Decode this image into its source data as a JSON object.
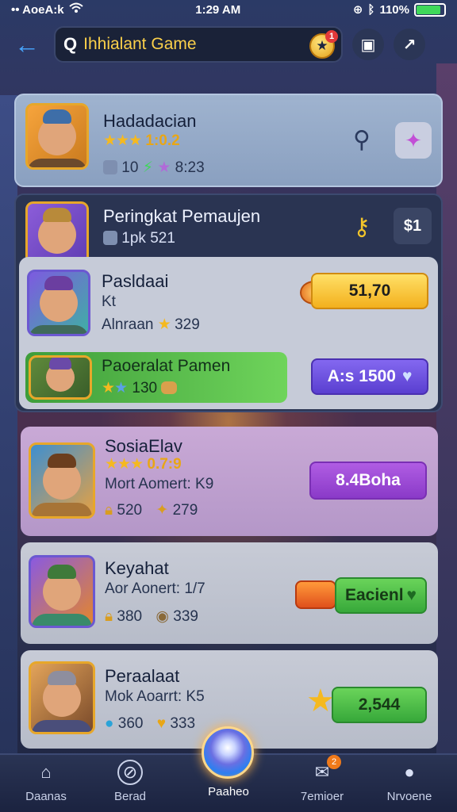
{
  "status_bar": {
    "carrier": "•• AoeA:k",
    "time": "1:29 AM",
    "battery": "110%"
  },
  "header": {
    "search_text": "Ihhialant Game",
    "notif_count": "1"
  },
  "cards": [
    {
      "name": "Hadadacian",
      "rating": "1:0.2",
      "stats_left": "10",
      "stats_right": "8:23"
    },
    {
      "name": "Peringkat Pemaujen",
      "stats": "1pk 521",
      "button": "$1"
    },
    {
      "name": "Pasldaai",
      "line2": "Kt",
      "line3": "Alnraan",
      "value": "329",
      "button": "51,70"
    },
    {
      "name": "Paoeralat Pamen",
      "value": "130",
      "button": "A:s 1500"
    },
    {
      "name": "SosiaElav",
      "rating": "0.7:9",
      "line2": "Mort Aomert: K9",
      "stat_a": "520",
      "stat_b": "279",
      "button": "8.4Boha"
    },
    {
      "name": "Keyahat",
      "line2": "Aor Aonert: 1/7",
      "stat_a": "380",
      "stat_b": "339",
      "button": "Eacienl"
    },
    {
      "name": "Peraalaat",
      "line2": "Mok Aoarrt: K5",
      "stat_a": "360",
      "stat_b": "333",
      "button": "2,544"
    }
  ],
  "nav": {
    "items": [
      {
        "label": "Daanas"
      },
      {
        "label": "Berad"
      },
      {
        "label": "Paaheo"
      },
      {
        "label": "7emioer"
      },
      {
        "label": "Nrvoene"
      }
    ],
    "badge": "2"
  }
}
